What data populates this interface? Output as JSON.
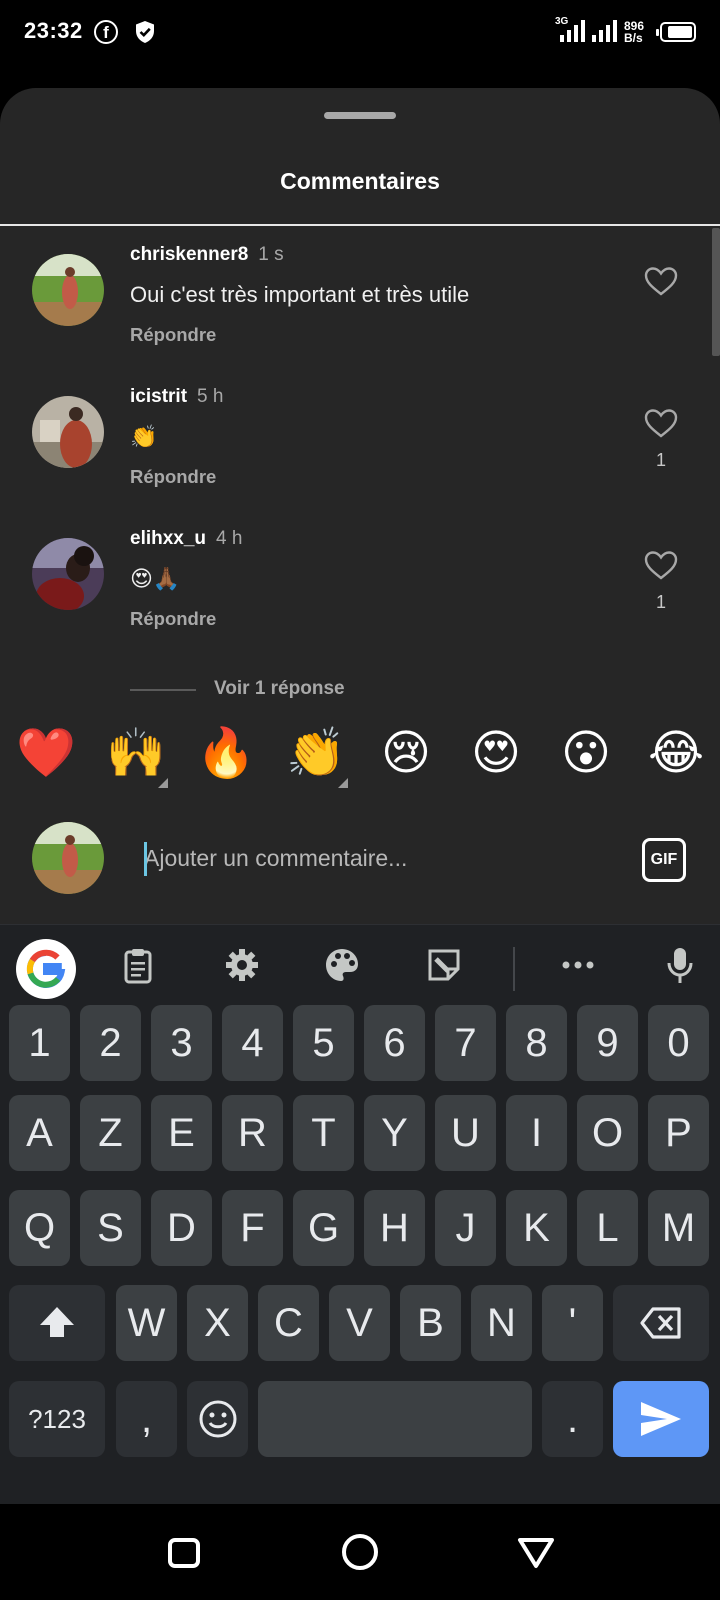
{
  "status_bar": {
    "time": "23:32",
    "network": "3G",
    "speed_value": "896",
    "speed_unit": "B/s"
  },
  "sheet": {
    "title": "Commentaires"
  },
  "comments": [
    {
      "username": "chriskenner8",
      "time": "1 s",
      "text": "Oui c'est très important et très utile",
      "reply_label": "Répondre",
      "likes": ""
    },
    {
      "username": "icistrit",
      "time": "5 h",
      "text": "👏",
      "reply_label": "Répondre",
      "likes": "1"
    },
    {
      "username": "elihxx_u",
      "time": "4 h",
      "text": "😍🙏🏾",
      "reply_label": "Répondre",
      "likes": "1"
    }
  ],
  "view_replies": "Voir 1 réponse",
  "quick_reactions": [
    "❤️",
    "🙌",
    "🔥",
    "👏",
    "😢",
    "😍",
    "😮",
    "😂"
  ],
  "composer": {
    "placeholder": "Ajouter un commentaire...",
    "gif_label": "GIF"
  },
  "keyboard": {
    "number_row": [
      "1",
      "2",
      "3",
      "4",
      "5",
      "6",
      "7",
      "8",
      "9",
      "0"
    ],
    "row1": [
      "A",
      "Z",
      "E",
      "R",
      "T",
      "Y",
      "U",
      "I",
      "O",
      "P"
    ],
    "row2": [
      "Q",
      "S",
      "D",
      "F",
      "G",
      "H",
      "J",
      "K",
      "L",
      "M"
    ],
    "row3": [
      "W",
      "X",
      "C",
      "V",
      "B",
      "N",
      "'"
    ],
    "symbols_label": "?123",
    "comma": ",",
    "period": "."
  },
  "colors": {
    "sheet_bg": "#262626",
    "key_bg": "#3c4043",
    "enter_key": "#5e97f6"
  }
}
